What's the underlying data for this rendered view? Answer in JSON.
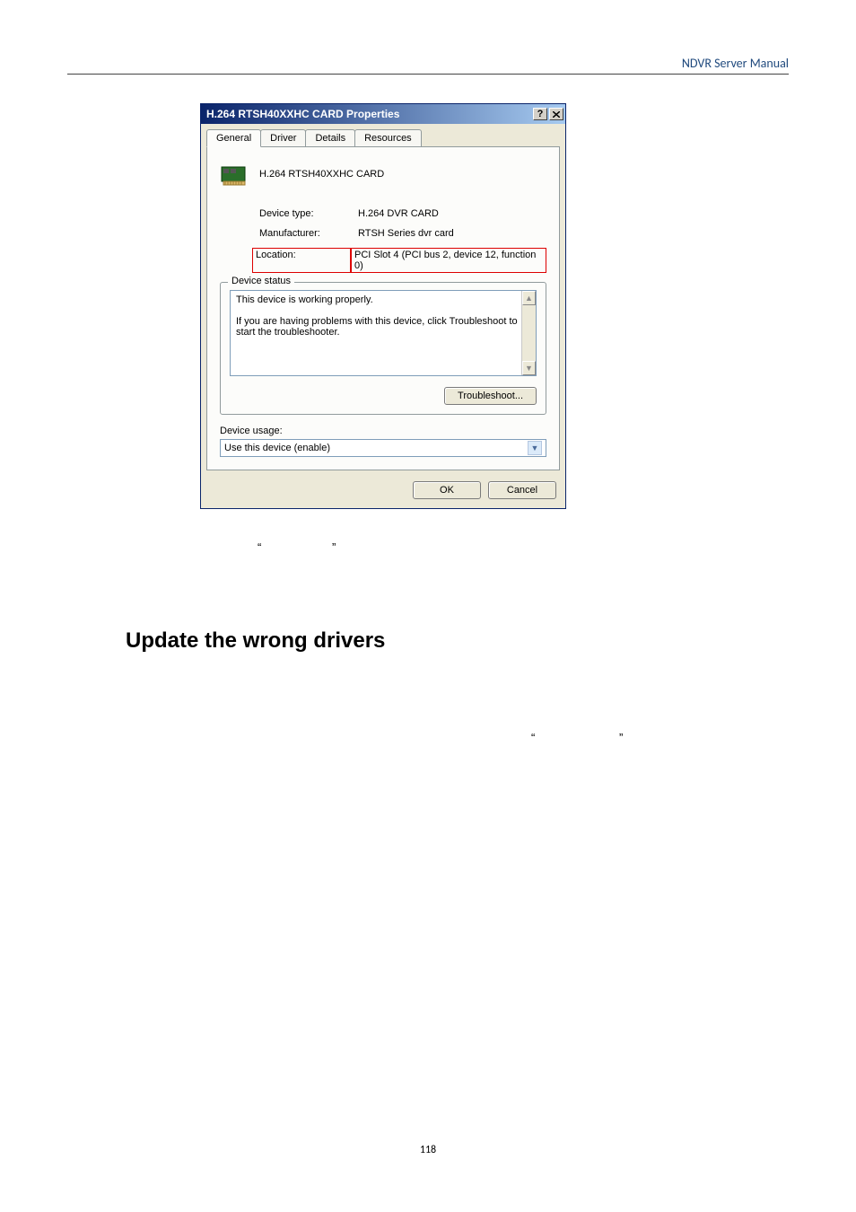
{
  "header": {
    "link": "NDVR Server Manual"
  },
  "dialog": {
    "title": "H.264 RTSH40XXHC CARD Properties",
    "tabs": [
      "General",
      "Driver",
      "Details",
      "Resources"
    ],
    "device_title": "H.264 RTSH40XXHC CARD",
    "rows": {
      "type_label": "Device type:",
      "type_value": "H.264 DVR CARD",
      "mfr_label": "Manufacturer:",
      "mfr_value": "RTSH Series dvr card",
      "loc_label": "Location:",
      "loc_value": "PCI Slot 4 (PCI bus 2, device 12, function 0)"
    },
    "status": {
      "legend": "Device status",
      "line1": "This device is working properly.",
      "line2": "If you are having problems with this device, click Troubleshoot to start the troubleshooter."
    },
    "troubleshoot_btn": "Troubleshoot...",
    "usage_label": "Device usage:",
    "usage_value": "Use this device (enable)",
    "ok": "OK",
    "cancel": "Cancel"
  },
  "quotes": {
    "open": "“",
    "close": "”"
  },
  "section_heading": "Update the wrong drivers",
  "page_number": "118"
}
